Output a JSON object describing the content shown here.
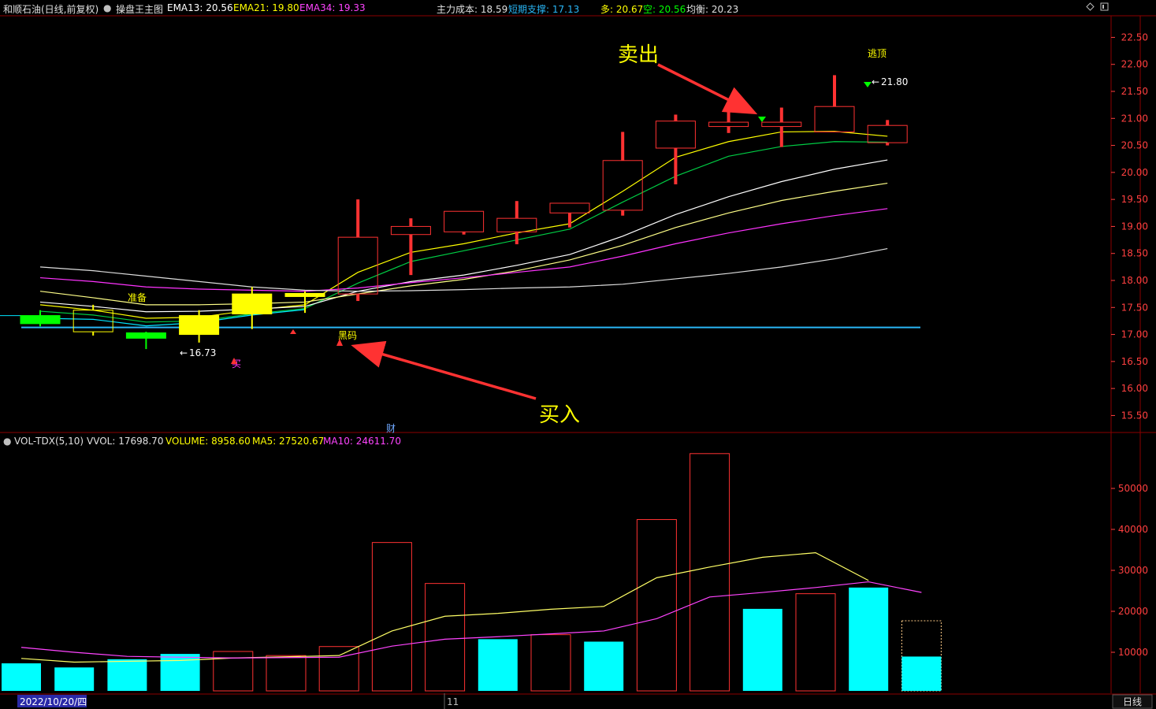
{
  "header": {
    "stock_title": "和顺石油(日线,前复权)",
    "indicator_name": "操盘王主图",
    "ema13": "EMA13: 20.56",
    "ema21": "EMA21: 19.80",
    "ema34": "EMA34: 19.33",
    "main_cost": "主力成本: 18.59",
    "short_support": "短期支撑: 17.13",
    "bull": "多: 20.67",
    "bear": "空: 20.56",
    "balance": "均衡: 20.23"
  },
  "vol_header": {
    "name": "VOL-TDX(5,10)",
    "vvol": "VVOL: 17698.70",
    "volume": "VOLUME: 8958.60",
    "ma5": "MA5: 27520.67",
    "ma10": "MA10: 24611.70"
  },
  "footer": {
    "date": "2022/10/20/四",
    "month_mark": "11",
    "period": "日线"
  },
  "annotations": {
    "sell": "卖出",
    "buy": "买入",
    "escape_top": "逃顶",
    "prepare": "准备",
    "dark_horse": "黑码",
    "buy_small": "买",
    "finance": "财",
    "high_label": "21.80",
    "low_label": "16.73"
  },
  "colors": {
    "up": "#ff3232",
    "down_green": "#00ff00",
    "yellow": "#ffff00",
    "cyan": "#00ffff",
    "magenta": "#ff00ff",
    "white": "#ffffff",
    "support": "#29b6f6",
    "grid": "#8b0000",
    "axis_text": "#ff4040"
  },
  "chart_data": [
    {
      "type": "candlestick",
      "yticks": [
        15.5,
        16.0,
        16.5,
        17.0,
        17.5,
        18.0,
        18.5,
        19.0,
        19.5,
        20.0,
        20.5,
        21.0,
        21.5,
        22.0,
        22.5
      ],
      "ylim": [
        15.2,
        22.9
      ],
      "candles": [
        {
          "open": 17.2,
          "close": 17.35,
          "high": 17.45,
          "low": 17.15,
          "style": "green-fill"
        },
        {
          "open": 17.45,
          "close": 17.05,
          "high": 17.55,
          "low": 16.98,
          "style": "yellow-outline"
        },
        {
          "open": 17.03,
          "close": 16.93,
          "high": 17.05,
          "low": 16.73,
          "style": "green-fill"
        },
        {
          "open": 17.0,
          "close": 17.35,
          "high": 17.45,
          "low": 16.85,
          "style": "yellow-fill"
        },
        {
          "open": 17.38,
          "close": 17.75,
          "high": 17.88,
          "low": 17.1,
          "style": "yellow-fill"
        },
        {
          "open": 17.73,
          "close": 17.76,
          "high": 17.8,
          "low": 17.4,
          "style": "yellow-fill"
        },
        {
          "open": 17.75,
          "close": 18.8,
          "high": 19.5,
          "low": 17.62,
          "style": "red-outline"
        },
        {
          "open": 18.85,
          "close": 19.0,
          "high": 19.15,
          "low": 18.1,
          "style": "red-outline"
        },
        {
          "open": 18.9,
          "close": 19.28,
          "high": 19.28,
          "low": 18.85,
          "style": "red-outline"
        },
        {
          "open": 18.9,
          "close": 19.15,
          "high": 19.47,
          "low": 18.67,
          "style": "red-outline"
        },
        {
          "open": 19.25,
          "close": 19.43,
          "high": 19.43,
          "low": 18.98,
          "style": "red-outline"
        },
        {
          "open": 19.3,
          "close": 20.22,
          "high": 20.75,
          "low": 19.2,
          "style": "red-outline"
        },
        {
          "open": 20.45,
          "close": 20.95,
          "high": 21.07,
          "low": 19.78,
          "style": "red-outline"
        },
        {
          "open": 20.85,
          "close": 20.93,
          "high": 21.18,
          "low": 20.73,
          "style": "red-outline"
        },
        {
          "open": 20.85,
          "close": 20.93,
          "high": 21.2,
          "low": 20.47,
          "style": "red-outline"
        },
        {
          "open": 20.75,
          "close": 21.22,
          "high": 21.8,
          "low": 20.75,
          "style": "red-outline"
        },
        {
          "open": 20.55,
          "close": 20.87,
          "high": 20.97,
          "low": 20.5,
          "style": "red-outline"
        }
      ],
      "support_level": 17.13,
      "lines": [
        {
          "name": "EMA13",
          "color": "#ffff00",
          "values": [
            17.55,
            17.45,
            17.3,
            17.32,
            17.45,
            17.55,
            18.15,
            18.52,
            18.68,
            18.88,
            19.05,
            19.65,
            20.28,
            20.57,
            20.75,
            20.76,
            20.67
          ]
        },
        {
          "name": "EMA21",
          "color": "#00cc44",
          "values": [
            17.43,
            17.36,
            17.23,
            17.25,
            17.38,
            17.48,
            17.95,
            18.35,
            18.55,
            18.75,
            18.95,
            19.45,
            19.93,
            20.3,
            20.48,
            20.57,
            20.56
          ]
        },
        {
          "name": "white1",
          "color": "#ffffff",
          "values": [
            17.6,
            17.52,
            17.42,
            17.43,
            17.47,
            17.52,
            17.8,
            17.98,
            18.1,
            18.28,
            18.48,
            18.82,
            19.22,
            19.55,
            19.83,
            20.06,
            20.23
          ]
        },
        {
          "name": "yellow2",
          "color": "#ffff88",
          "values": [
            17.8,
            17.68,
            17.55,
            17.55,
            17.57,
            17.6,
            17.75,
            17.9,
            18.02,
            18.18,
            18.38,
            18.65,
            18.98,
            19.25,
            19.48,
            19.65,
            19.8
          ]
        },
        {
          "name": "EMA34",
          "color": "#ff33ff",
          "values": [
            18.05,
            17.98,
            17.88,
            17.84,
            17.82,
            17.8,
            17.86,
            17.96,
            18.05,
            18.15,
            18.25,
            18.45,
            18.68,
            18.88,
            19.05,
            19.2,
            19.33
          ]
        },
        {
          "name": "long",
          "color": "#dddddd",
          "values": [
            18.25,
            18.18,
            18.08,
            17.98,
            17.88,
            17.82,
            17.8,
            17.81,
            17.83,
            17.86,
            17.88,
            17.93,
            18.03,
            18.13,
            18.25,
            18.4,
            18.59
          ]
        },
        {
          "name": "cyan-line",
          "color": "#00e5ff",
          "values": [
            17.3,
            17.28,
            17.16,
            17.22,
            17.36,
            17.46,
            null,
            null,
            null,
            null,
            null,
            null,
            null,
            null,
            null,
            null,
            null
          ]
        }
      ]
    },
    {
      "type": "bar",
      "yticks": [
        10000,
        20000,
        30000,
        40000,
        50000
      ],
      "ylim": [
        0,
        60000
      ],
      "volumes": [
        7300,
        6300,
        8300,
        9600,
        10200,
        9200,
        11400,
        36800,
        26800,
        13200,
        14300,
        12600,
        42400,
        58500,
        20600,
        24300,
        25800,
        17700
      ],
      "volume_styles": [
        "cyan",
        "cyan",
        "cyan",
        "cyan",
        "red-outline",
        "red-outline",
        "red-outline",
        "red-outline",
        "red-outline",
        "cyan",
        "red-outline",
        "cyan",
        "red-outline",
        "red-outline",
        "cyan",
        "red-outline",
        "cyan",
        "dotted"
      ],
      "current_volume": 8958.6,
      "ma5": [
        8500,
        7600,
        7800,
        8000,
        8600,
        8900,
        9200,
        15200,
        18800,
        19500,
        20500,
        21200,
        28200,
        30800,
        33200,
        34300,
        27520.67
      ],
      "ma10": [
        11200,
        10000,
        9000,
        8800,
        8600,
        8700,
        8800,
        11500,
        13200,
        13800,
        14500,
        15200,
        18200,
        23500,
        24600,
        25800,
        27200,
        24611.7
      ]
    }
  ]
}
